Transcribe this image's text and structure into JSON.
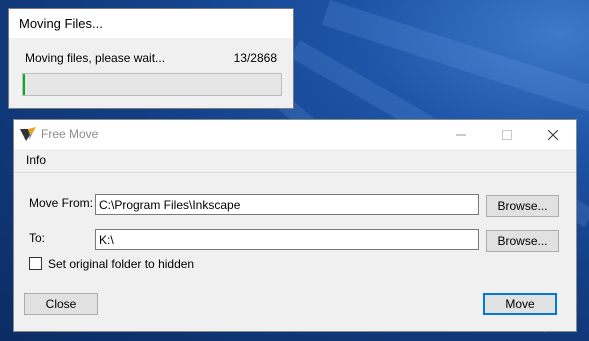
{
  "progress_dialog": {
    "title": "Moving Files...",
    "message": "Moving files, please wait...",
    "count": "13/2868",
    "progress": 0.0045
  },
  "main_window": {
    "title": "Free Move",
    "menu": {
      "info": "Info"
    },
    "move_from": {
      "label": "Move From:",
      "value": "C:\\Program Files\\Inkscape",
      "browse": "Browse..."
    },
    "to": {
      "label": "To:",
      "value": "K:\\",
      "browse": "Browse..."
    },
    "hidden_checkbox": {
      "label": "Set original folder to hidden",
      "checked": false
    },
    "close_button": "Close",
    "move_button": "Move"
  },
  "colors": {
    "progress_fill": "#06b025",
    "accent": "#0078d7"
  }
}
